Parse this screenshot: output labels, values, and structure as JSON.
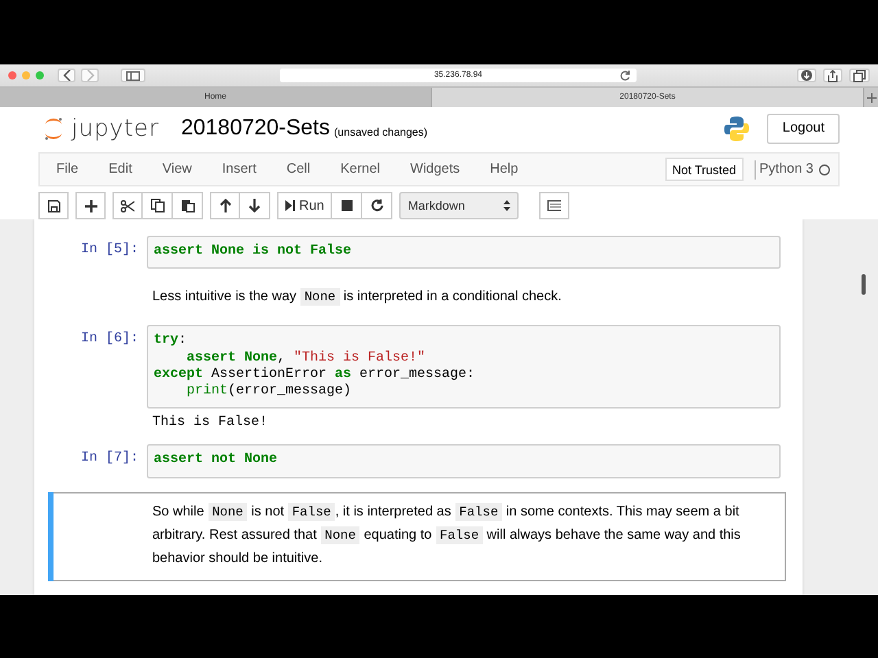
{
  "browser": {
    "address": "35.236.78.94",
    "tabs": [
      {
        "label": "Home",
        "selected": false
      },
      {
        "label": "20180720-Sets",
        "selected": true
      }
    ]
  },
  "header": {
    "logo": "jupyter",
    "title": "20180720-Sets",
    "save_status": "(unsaved changes)",
    "logout": "Logout"
  },
  "menu": {
    "items": [
      "File",
      "Edit",
      "View",
      "Insert",
      "Cell",
      "Kernel",
      "Widgets",
      "Help"
    ],
    "trusted": "Not Trusted",
    "kernel": "Python 3",
    "kernel_busy": false
  },
  "toolbar": {
    "run": "Run",
    "cell_type": "Markdown"
  },
  "cells": [
    {
      "kind": "code",
      "prompt": "In [5]:",
      "lines": [
        [
          {
            "kind": "kw",
            "text": "assert None is not False"
          }
        ]
      ],
      "selected": false
    },
    {
      "kind": "markdown",
      "segments": [
        {
          "kind": "text",
          "text": "Less intuitive is the way "
        },
        {
          "kind": "code",
          "text": "None"
        },
        {
          "kind": "text",
          "text": " is interpreted in a conditional check."
        }
      ],
      "selected": false
    },
    {
      "kind": "code",
      "prompt": "In [6]:",
      "lines": [
        [
          {
            "kind": "kw",
            "text": "try"
          },
          {
            "kind": "plain",
            "text": ":"
          }
        ],
        [
          {
            "kind": "kw",
            "text": "    assert None"
          },
          {
            "kind": "plain",
            "text": ", "
          },
          {
            "kind": "str",
            "text": "\"This is False!\""
          }
        ],
        [
          {
            "kind": "kw",
            "text": "except"
          },
          {
            "kind": "plain",
            "text": " AssertionError "
          },
          {
            "kind": "kw",
            "text": "as"
          },
          {
            "kind": "plain",
            "text": " error_message:"
          }
        ],
        [
          {
            "kind": "builtin",
            "text": "    print"
          },
          {
            "kind": "plain",
            "text": "(error_message)"
          }
        ]
      ],
      "output": "This is False!",
      "selected": false
    },
    {
      "kind": "code",
      "prompt": "In [7]:",
      "lines": [
        [
          {
            "kind": "kw",
            "text": "assert not None"
          }
        ]
      ],
      "selected": false
    },
    {
      "kind": "markdown",
      "segments": [
        {
          "kind": "text",
          "text": "So while "
        },
        {
          "kind": "code",
          "text": "None"
        },
        {
          "kind": "text",
          "text": " is not "
        },
        {
          "kind": "code",
          "text": "False"
        },
        {
          "kind": "text",
          "text": ", it is interpreted as "
        },
        {
          "kind": "code",
          "text": "False"
        },
        {
          "kind": "text",
          "text": " in some contexts. This may seem a bit arbitrary. Rest assured that "
        },
        {
          "kind": "code",
          "text": "None"
        },
        {
          "kind": "text",
          "text": " equating to "
        },
        {
          "kind": "code",
          "text": "False"
        },
        {
          "kind": "text",
          "text": " will always behave the same way and this behavior should be intuitive."
        }
      ],
      "selected": true
    }
  ]
}
